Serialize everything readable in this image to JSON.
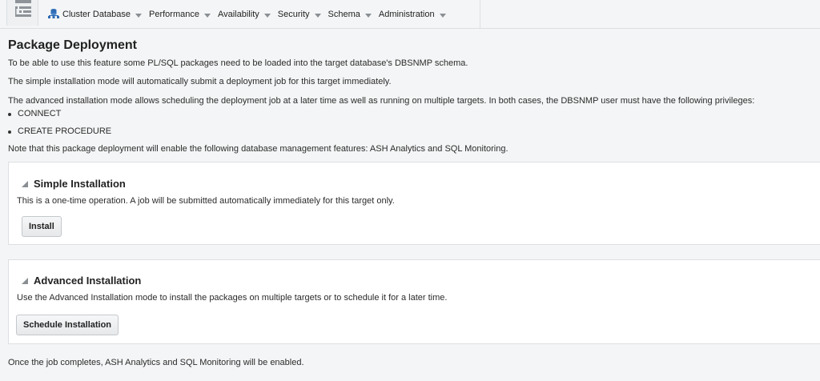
{
  "menubar": {
    "items": [
      {
        "label": "Cluster Database",
        "has_icon": true
      },
      {
        "label": "Performance"
      },
      {
        "label": "Availability"
      },
      {
        "label": "Security"
      },
      {
        "label": "Schema"
      },
      {
        "label": "Administration"
      }
    ]
  },
  "page": {
    "title": "Package Deployment",
    "intro_1": "To be able to use this feature some PL/SQL packages need to be loaded into the target database's DBSNMP schema.",
    "intro_2": "The simple installation mode will automatically submit a deployment job for this target immediately.",
    "intro_3": "The advanced installation mode allows scheduling the deployment job at a later time as well as running on multiple targets. In both cases, the DBSNMP user must have the following privileges:",
    "privileges": [
      "CONNECT",
      "CREATE PROCEDURE"
    ],
    "intro_4": "Note that this package deployment will enable the following database management features: ASH Analytics and SQL Monitoring.",
    "footer": "Once the job completes, ASH Analytics and SQL Monitoring will be enabled."
  },
  "simple": {
    "title": "Simple Installation",
    "description": "This is a one-time operation. A job will be submitted automatically immediately for this target only.",
    "button": "Install"
  },
  "advanced": {
    "title": "Advanced Installation",
    "description": "Use the Advanced Installation mode to install the packages on multiple targets or to schedule it for a later time.",
    "button": "Schedule Installation"
  },
  "colors": {
    "background": "#f4f5f6",
    "panel": "#ffffff",
    "border": "#dcdfe2",
    "db_icon": "#2f6db5"
  }
}
